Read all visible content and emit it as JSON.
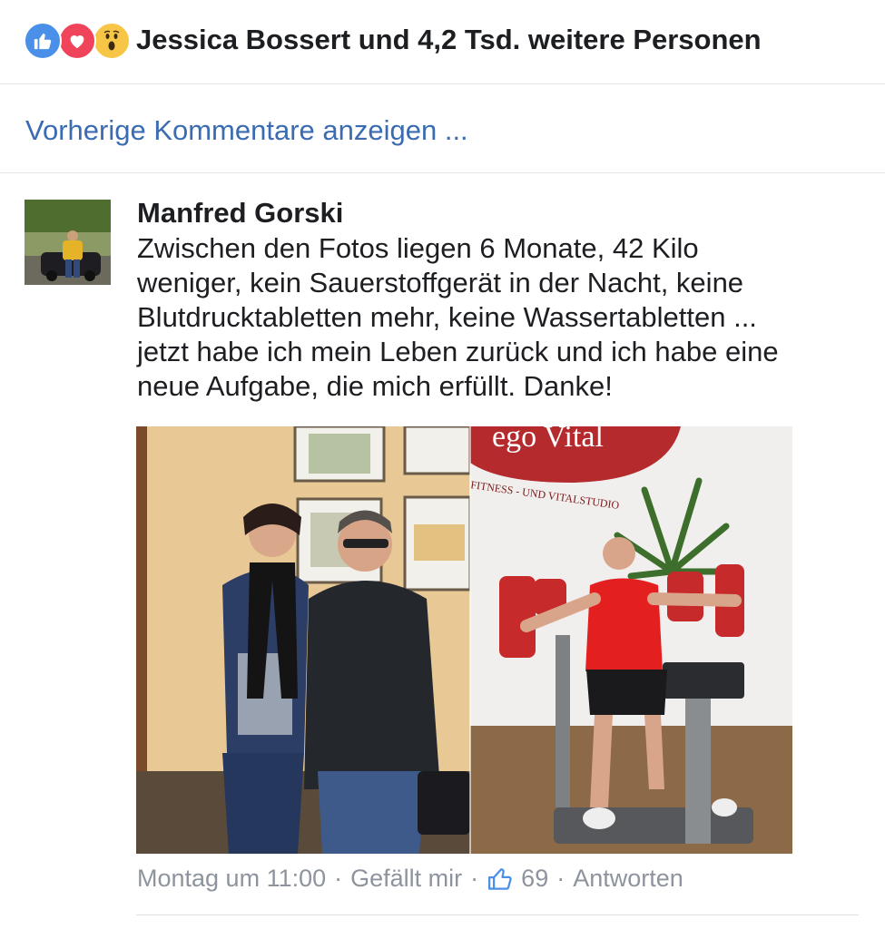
{
  "reactions": {
    "icons": [
      "like-icon",
      "love-icon",
      "wow-icon"
    ],
    "summary": "Jessica Bossert und 4,2 Tsd. weitere Personen"
  },
  "previous_comments": {
    "label": "Vorherige Kommentare anzeigen ..."
  },
  "comment": {
    "author": "Manfred Gorski",
    "lines": [
      "Zwischen den Fotos liegen 6 Monate, 42 Kilo",
      "weniger, kein Sauerstoffgerät in der Nacht, keine",
      "Blutdrucktabletten mehr, keine Wassertabletten ...",
      "jetzt habe ich mein Leben zurück und ich habe eine",
      "neue Aufgabe, die mich erfüllt. Danke!"
    ],
    "photo": {
      "sign_text": "ego Vital",
      "sign_subtext": "FITNESS - UND VITALSTUDIO"
    },
    "meta": {
      "time": "Montag um 11:00",
      "like": "Gefällt mir",
      "like_count": "69",
      "reply": "Antworten",
      "separator": "·"
    }
  },
  "colors": {
    "link": "#3b6bb0",
    "meta_gray": "#8d949e",
    "like_blue": "#4a90e8",
    "love_red": "#f0445a",
    "wow_yellow": "#f7c646"
  }
}
